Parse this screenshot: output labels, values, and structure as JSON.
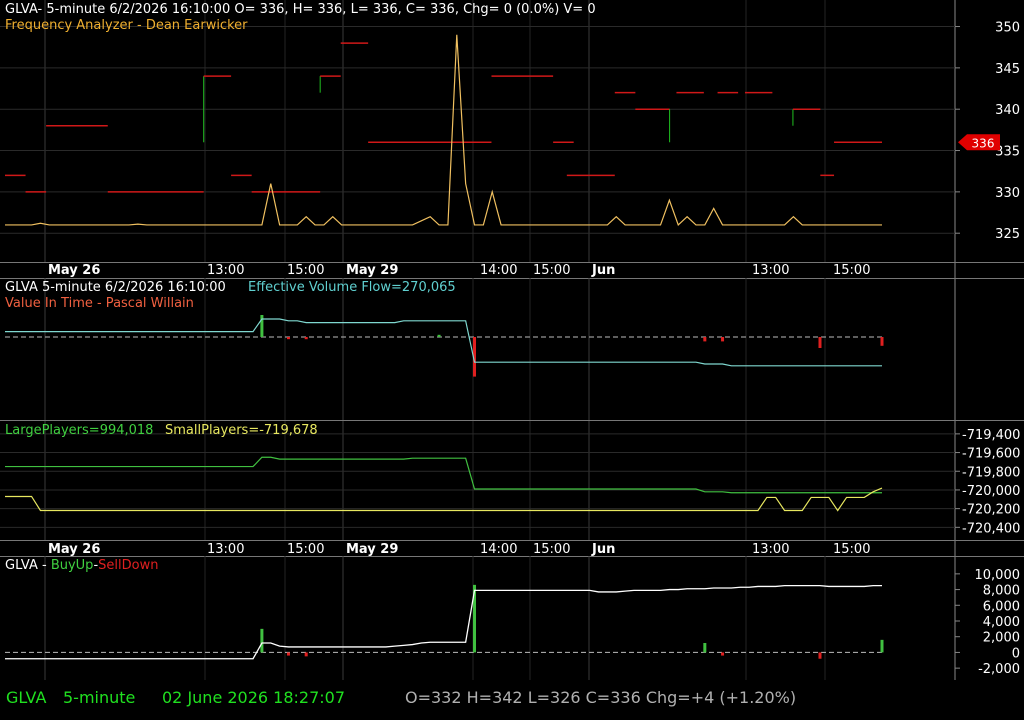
{
  "panels": {
    "price": {
      "header": "GLVA- 5-minute 6/2/2026 16:10:00 O= 336, H= 336, L= 336, C= 336, Chg= 0 (0.0%) V= 0",
      "indicator": "Frequency Analyzer - Dean Earwicker",
      "last_value_badge": "336"
    },
    "volume": {
      "header": "GLVA 5-minute  6/2/2026 16:10:00",
      "flow_label": "Effective Volume Flow=270,065",
      "indicator": "Value In Time - Pascal Willain"
    },
    "players": {
      "large_label": "LargePlayers=994,018",
      "small_label": "SmallPlayers=-719,678"
    },
    "buyup": {
      "prefix": "GLVA - ",
      "buy": "BuyUp",
      "dash": "-",
      "sell": "SellDown"
    }
  },
  "time_axis": {
    "labels": [
      "May 26",
      "13:00",
      "15:00",
      "May 29",
      "14:00",
      "15:00",
      "Jun",
      "13:00",
      "15:00"
    ]
  },
  "status_bar": {
    "symbol": "GLVA",
    "interval": "5-minute",
    "datetime": "02 June 2026 18:27:07",
    "ohlc": "O=332  H=342  L=326  C=336  Chg=+4 (+1.20%)"
  },
  "colors": {
    "background": "#000000",
    "grid": "#2a2a2a",
    "price_line": "#f0c060",
    "frequency_red": "#d01818",
    "frequency_green": "#20c020",
    "flow_line": "#7fd8d0",
    "large_players": "#40c040",
    "small_players": "#e8e860",
    "buyup_line": "#ffffff",
    "volume_up": "#40c040",
    "volume_down": "#e02020",
    "status_green": "#20e020",
    "status_gray": "#b0b0b0"
  },
  "chart_data": [
    {
      "type": "line",
      "panel": "price",
      "ylim": [
        322,
        352
      ],
      "yticks": [
        325,
        330,
        335,
        340,
        345,
        350
      ],
      "x_count": 100,
      "series": [
        {
          "values": [
            326,
            326,
            326,
            326,
            326.2,
            326,
            326,
            326,
            326,
            326,
            326,
            326,
            326,
            326,
            326,
            326.1,
            326,
            326,
            326,
            326,
            326,
            326,
            326,
            326,
            326,
            326,
            326,
            326,
            326,
            326,
            331,
            326,
            326,
            326,
            327,
            326,
            326,
            327,
            326,
            326,
            326,
            326,
            326,
            326,
            326,
            326,
            326,
            326.5,
            327,
            326,
            326,
            349,
            331,
            326,
            326,
            330,
            326,
            326,
            326,
            326,
            326,
            326,
            326,
            326,
            326,
            326,
            326,
            326,
            326,
            327,
            326,
            326,
            326,
            326,
            326,
            329,
            326,
            327,
            326,
            326,
            328,
            326,
            326,
            326,
            326,
            326,
            326,
            326,
            326,
            327,
            326,
            326,
            326,
            326,
            326,
            326,
            326,
            326,
            326,
            326
          ]
        }
      ],
      "frequency_steps": [
        {
          "x0": 0,
          "x1": 3,
          "y": 332,
          "color": "red"
        },
        {
          "x0": 3,
          "x1": 6,
          "y": 330,
          "color": "red"
        },
        {
          "x0": 6,
          "x1": 15,
          "y": 338,
          "color": "red"
        },
        {
          "x0": 15,
          "x1": 29,
          "y": 330,
          "color": "red"
        },
        {
          "x0": 29,
          "x1": 29,
          "y0": 336,
          "y": 344,
          "color": "green"
        },
        {
          "x0": 29,
          "x1": 33,
          "y": 344,
          "color": "red"
        },
        {
          "x0": 33,
          "x1": 36,
          "y": 332,
          "color": "red"
        },
        {
          "x0": 36,
          "x1": 46,
          "y": 330,
          "color": "red"
        },
        {
          "x0": 46,
          "x1": 46,
          "y0": 342,
          "y": 344,
          "color": "green"
        },
        {
          "x0": 46,
          "x1": 49,
          "y": 344,
          "color": "red"
        },
        {
          "x0": 49,
          "x1": 53,
          "y": 348,
          "color": "red"
        },
        {
          "x0": 53,
          "x1": 71,
          "y": 336,
          "color": "red"
        },
        {
          "x0": 71,
          "x1": 80,
          "y": 344,
          "color": "red"
        },
        {
          "x0": 80,
          "x1": 83,
          "y": 336,
          "color": "red"
        },
        {
          "x0": 82,
          "x1": 89,
          "y": 332,
          "color": "red"
        },
        {
          "x0": 89,
          "x1": 92,
          "y": 342,
          "color": "red"
        },
        {
          "x0": 92,
          "x1": 97,
          "y": 340,
          "color": "red"
        },
        {
          "x0": 97,
          "x1": 97,
          "y0": 336,
          "y": 340,
          "color": "green"
        },
        {
          "x0": 98,
          "x1": 102,
          "y": 342,
          "color": "red"
        },
        {
          "x0": 104,
          "x1": 107,
          "y": 342,
          "color": "red"
        },
        {
          "x0": 108,
          "x1": 112,
          "y": 342,
          "color": "red"
        },
        {
          "x0": 115,
          "x1": 115,
          "y0": 338,
          "y": 340,
          "color": "green"
        },
        {
          "x0": 115,
          "x1": 119,
          "y": 340,
          "color": "red"
        },
        {
          "x0": 119,
          "x1": 121,
          "y": 332,
          "color": "red"
        },
        {
          "x0": 121,
          "x1": 128,
          "y": 336,
          "color": "red"
        }
      ]
    },
    {
      "type": "line",
      "panel": "volume",
      "series": [
        {
          "name": "Effective Volume Flow",
          "values": [
            0.3,
            0.3,
            0.3,
            0.3,
            0.3,
            0.3,
            0.3,
            0.3,
            0.3,
            0.3,
            0.3,
            0.3,
            0.3,
            0.3,
            0.3,
            0.3,
            0.3,
            0.3,
            0.3,
            0.3,
            0.3,
            0.3,
            0.3,
            0.3,
            0.3,
            0.3,
            0.3,
            0.3,
            0.3,
            1.0,
            1.0,
            1.0,
            0.9,
            0.9,
            0.8,
            0.8,
            0.8,
            0.8,
            0.8,
            0.8,
            0.8,
            0.8,
            0.8,
            0.8,
            0.8,
            0.9,
            0.9,
            0.9,
            0.9,
            0.9,
            0.9,
            0.9,
            0.9,
            -1.4,
            -1.4,
            -1.4,
            -1.4,
            -1.4,
            -1.4,
            -1.4,
            -1.4,
            -1.4,
            -1.4,
            -1.4,
            -1.4,
            -1.4,
            -1.4,
            -1.4,
            -1.4,
            -1.4,
            -1.4,
            -1.4,
            -1.4,
            -1.4,
            -1.4,
            -1.4,
            -1.4,
            -1.4,
            -1.4,
            -1.5,
            -1.5,
            -1.5,
            -1.6,
            -1.6,
            -1.6,
            -1.6,
            -1.6,
            -1.6,
            -1.6,
            -1.6,
            -1.6,
            -1.6,
            -1.6,
            -1.6,
            -1.6,
            -1.6,
            -1.6,
            -1.6,
            -1.6,
            -1.6
          ]
        }
      ],
      "histogram": [
        0,
        0,
        0,
        0,
        0,
        0,
        0,
        0,
        0,
        0,
        0,
        0,
        0,
        0,
        0,
        0,
        0,
        0,
        0,
        0,
        0,
        0,
        0,
        0,
        0,
        0,
        0,
        0,
        0,
        1.0,
        0,
        0,
        -0.1,
        0,
        -0.1,
        0,
        0,
        0,
        0,
        0,
        0,
        0,
        0,
        0,
        0,
        0,
        0,
        0,
        0,
        0.1,
        0,
        0,
        0,
        -1.8,
        0,
        0,
        0,
        0,
        0,
        0,
        0,
        0,
        0,
        0,
        0,
        0,
        0,
        0,
        0,
        0,
        0,
        0,
        0,
        0,
        0,
        0,
        0,
        0,
        0,
        -0.2,
        0,
        -0.2,
        0,
        0,
        0,
        0,
        0,
        0,
        0,
        0,
        0,
        0,
        -0.5,
        0,
        0,
        0,
        0,
        0,
        0,
        -0.4,
        0
      ]
    },
    {
      "type": "line",
      "panel": "players",
      "ylim": [
        -720450,
        -719380
      ],
      "yticks": [
        -719400,
        -719600,
        -719800,
        -720000,
        -720200,
        -720400
      ],
      "series": [
        {
          "name": "LargePlayers",
          "values": [
            -719750,
            -719750,
            -719750,
            -719750,
            -719750,
            -719750,
            -719750,
            -719750,
            -719750,
            -719750,
            -719750,
            -719750,
            -719750,
            -719750,
            -719750,
            -719750,
            -719750,
            -719750,
            -719750,
            -719750,
            -719750,
            -719750,
            -719750,
            -719750,
            -719750,
            -719750,
            -719750,
            -719750,
            -719750,
            -719650,
            -719650,
            -719670,
            -719670,
            -719670,
            -719670,
            -719670,
            -719670,
            -719670,
            -719670,
            -719670,
            -719670,
            -719670,
            -719670,
            -719670,
            -719670,
            -719670,
            -719660,
            -719660,
            -719660,
            -719660,
            -719660,
            -719660,
            -719660,
            -719990,
            -719990,
            -719990,
            -719990,
            -719990,
            -719990,
            -719990,
            -719990,
            -719990,
            -719990,
            -719990,
            -719990,
            -719990,
            -719990,
            -719990,
            -719990,
            -719990,
            -719990,
            -719990,
            -719990,
            -719990,
            -719990,
            -719990,
            -719990,
            -719990,
            -719990,
            -720020,
            -720020,
            -720020,
            -720030,
            -720030,
            -720030,
            -720030,
            -720030,
            -720030,
            -720030,
            -720030,
            -720030,
            -720030,
            -720030,
            -720030,
            -720030,
            -720030,
            -720030,
            -720030,
            -720030,
            -720030
          ]
        },
        {
          "name": "SmallPlayers",
          "values": [
            -720070,
            -720070,
            -720070,
            -720070,
            -720220,
            -720220,
            -720220,
            -720220,
            -720220,
            -720220,
            -720220,
            -720220,
            -720220,
            -720220,
            -720220,
            -720220,
            -720220,
            -720220,
            -720220,
            -720220,
            -720220,
            -720220,
            -720220,
            -720220,
            -720220,
            -720220,
            -720220,
            -720220,
            -720220,
            -720220,
            -720220,
            -720220,
            -720220,
            -720220,
            -720220,
            -720220,
            -720220,
            -720220,
            -720220,
            -720220,
            -720220,
            -720220,
            -720220,
            -720220,
            -720220,
            -720220,
            -720220,
            -720220,
            -720220,
            -720220,
            -720220,
            -720220,
            -720220,
            -720220,
            -720220,
            -720220,
            -720220,
            -720220,
            -720220,
            -720220,
            -720220,
            -720220,
            -720220,
            -720220,
            -720220,
            -720220,
            -720220,
            -720220,
            -720220,
            -720220,
            -720220,
            -720220,
            -720220,
            -720220,
            -720220,
            -720220,
            -720220,
            -720220,
            -720220,
            -720220,
            -720220,
            -720220,
            -720220,
            -720220,
            -720220,
            -720220,
            -720080,
            -720080,
            -720220,
            -720220,
            -720220,
            -720080,
            -720080,
            -720080,
            -720220,
            -720080,
            -720080,
            -720080,
            -720020,
            -719980
          ]
        }
      ]
    },
    {
      "type": "line",
      "panel": "buyup",
      "ylim": [
        -3000,
        11000
      ],
      "yticks": [
        10000,
        8000,
        6000,
        4000,
        2000,
        0,
        -2000
      ],
      "series": [
        {
          "values": [
            -800,
            -800,
            -800,
            -800,
            -800,
            -800,
            -800,
            -800,
            -800,
            -800,
            -800,
            -800,
            -800,
            -800,
            -800,
            -800,
            -800,
            -800,
            -800,
            -800,
            -800,
            -800,
            -800,
            -800,
            -800,
            -800,
            -800,
            -800,
            -800,
            1200,
            1200,
            800,
            700,
            700,
            700,
            700,
            700,
            700,
            700,
            700,
            700,
            700,
            700,
            700,
            800,
            900,
            1000,
            1200,
            1300,
            1300,
            1300,
            1300,
            1300,
            7900,
            7900,
            7900,
            7900,
            7900,
            7900,
            7900,
            7900,
            7900,
            7900,
            7900,
            7900,
            7900,
            7900,
            7700,
            7700,
            7700,
            7800,
            7900,
            7900,
            7900,
            7900,
            8000,
            8000,
            8100,
            8100,
            8100,
            8200,
            8200,
            8200,
            8300,
            8300,
            8400,
            8400,
            8400,
            8500,
            8500,
            8500,
            8500,
            8500,
            8400,
            8400,
            8400,
            8400,
            8400,
            8500,
            8500
          ]
        }
      ],
      "histogram": [
        0,
        0,
        0,
        0,
        0,
        0,
        0,
        0,
        0,
        0,
        0,
        0,
        0,
        0,
        0,
        0,
        0,
        0,
        0,
        0,
        0,
        0,
        0,
        0,
        0,
        0,
        0,
        0,
        0,
        3000,
        0,
        0,
        -400,
        0,
        -500,
        0,
        0,
        0,
        0,
        0,
        0,
        0,
        0,
        0,
        0,
        0,
        0,
        0,
        0,
        0,
        0,
        0,
        0,
        8600,
        0,
        0,
        0,
        0,
        0,
        0,
        0,
        0,
        0,
        0,
        0,
        0,
        0,
        0,
        0,
        0,
        0,
        0,
        0,
        0,
        0,
        0,
        0,
        0,
        0,
        1200,
        0,
        -400,
        0,
        0,
        0,
        0,
        0,
        0,
        0,
        0,
        0,
        0,
        -800,
        0,
        0,
        0,
        0,
        0,
        0,
        1600,
        0
      ]
    }
  ]
}
